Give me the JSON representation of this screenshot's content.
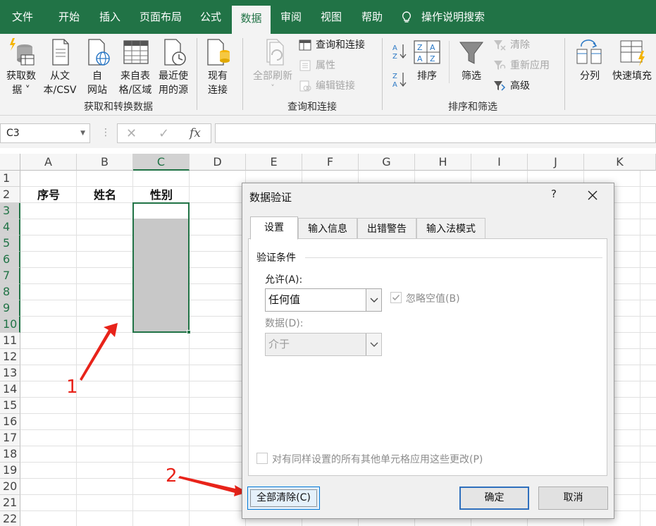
{
  "menu": {
    "tabs": [
      "文件",
      "开始",
      "插入",
      "页面布局",
      "公式",
      "数据",
      "审阅",
      "视图",
      "帮助"
    ],
    "active_tab": "数据",
    "tell_me": "操作说明搜索"
  },
  "ribbon": {
    "get_transform": {
      "label": "获取和转换数据",
      "get_data": [
        "获取数",
        "据 ˅"
      ],
      "from_text_csv": [
        "从文",
        "本/CSV"
      ],
      "from_web": [
        "自",
        "网站"
      ],
      "from_table": [
        "来自表",
        "格/区域"
      ],
      "recent_sources": [
        "最近使",
        "用的源"
      ],
      "existing_connections": [
        "现有",
        "连接"
      ]
    },
    "queries": {
      "label": "查询和连接",
      "refresh_all": [
        "全部刷新",
        "˅"
      ],
      "queries_connections": "查询和连接",
      "properties": "属性",
      "edit_links": "编辑链接"
    },
    "sort_filter": {
      "label": "排序和筛选",
      "sort": "排序",
      "filter": "筛选",
      "clear": "清除",
      "reapply": "重新应用",
      "advanced": "高级"
    },
    "data_tools": {
      "text_to_columns": "分列",
      "flash_fill": "快速填充"
    }
  },
  "formula_bar": {
    "name_box": "C3",
    "fx": "fx",
    "content": ""
  },
  "sheet": {
    "columns": [
      "A",
      "B",
      "C",
      "D",
      "E",
      "F",
      "G",
      "H",
      "I",
      "J",
      "K"
    ],
    "selected_column": "C",
    "rows": [
      "1",
      "2",
      "3",
      "4",
      "5",
      "6",
      "7",
      "8",
      "9",
      "10",
      "11",
      "12",
      "13",
      "14",
      "15",
      "16",
      "17",
      "18",
      "19",
      "20",
      "21",
      "22"
    ],
    "selected_rows": [
      "3",
      "4",
      "5",
      "6",
      "7",
      "8",
      "9",
      "10"
    ],
    "header_cells": {
      "A2": "序号",
      "B2": "姓名",
      "C2": "性别"
    }
  },
  "annotations": {
    "step1": "1",
    "step2": "2",
    "color": "#e8231a"
  },
  "dialog": {
    "title": "数据验证",
    "help": "?",
    "tabs": [
      "设置",
      "输入信息",
      "出错警告",
      "输入法模式"
    ],
    "active_tab": "设置",
    "group_title": "验证条件",
    "allow_label": "允许(A):",
    "allow_value": "任何值",
    "ignore_blank_label": "忽略空值(B)",
    "ignore_blank_checked": true,
    "data_label": "数据(D):",
    "data_value": "介于",
    "apply_all_label": "对有同样设置的所有其他单元格应用这些更改(P)",
    "apply_all_checked": false,
    "clear_all": "全部清除(C)",
    "ok": "确定",
    "cancel": "取消"
  },
  "colors": {
    "excel_green": "#217346",
    "ribbon_bg": "#f3f3f3",
    "selection_fill": "#c8c8c8"
  }
}
